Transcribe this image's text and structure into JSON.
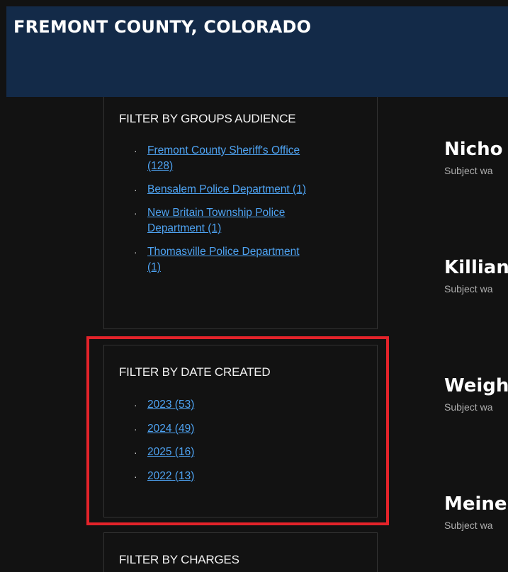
{
  "header": {
    "title": "FREMONT COUNTY, COLORADO",
    "background_color": "#132a48"
  },
  "filters": {
    "groups": {
      "heading": "FILTER BY GROUPS AUDIENCE",
      "items": [
        {
          "line1": "Fremont County Sheriff's Office",
          "line2": "(128)"
        },
        {
          "line1": "Bensalem Police Department (1)",
          "line2": ""
        },
        {
          "line1": "New Britain Township Police",
          "line2": "Department (1)"
        },
        {
          "line1": "Thomasville Police Department",
          "line2": "(1)"
        }
      ]
    },
    "date_created": {
      "heading": "FILTER BY DATE CREATED",
      "items": [
        {
          "label": "2023 (53)"
        },
        {
          "label": "2024 (49)"
        },
        {
          "label": "2025 (16)"
        },
        {
          "label": "2022 (13)"
        }
      ]
    },
    "charges": {
      "heading": "FILTER BY CHARGES"
    }
  },
  "results": [
    {
      "name": "Nicho",
      "desc": "Subject wa"
    },
    {
      "name": "Killian",
      "desc": "Subject wa"
    },
    {
      "name": "Weigh",
      "desc": "Subject wa"
    },
    {
      "name": "Meine",
      "desc": "Subject wa"
    }
  ],
  "colors": {
    "link": "#4ea3f2",
    "highlight": "#e3232a",
    "background": "#121212"
  }
}
